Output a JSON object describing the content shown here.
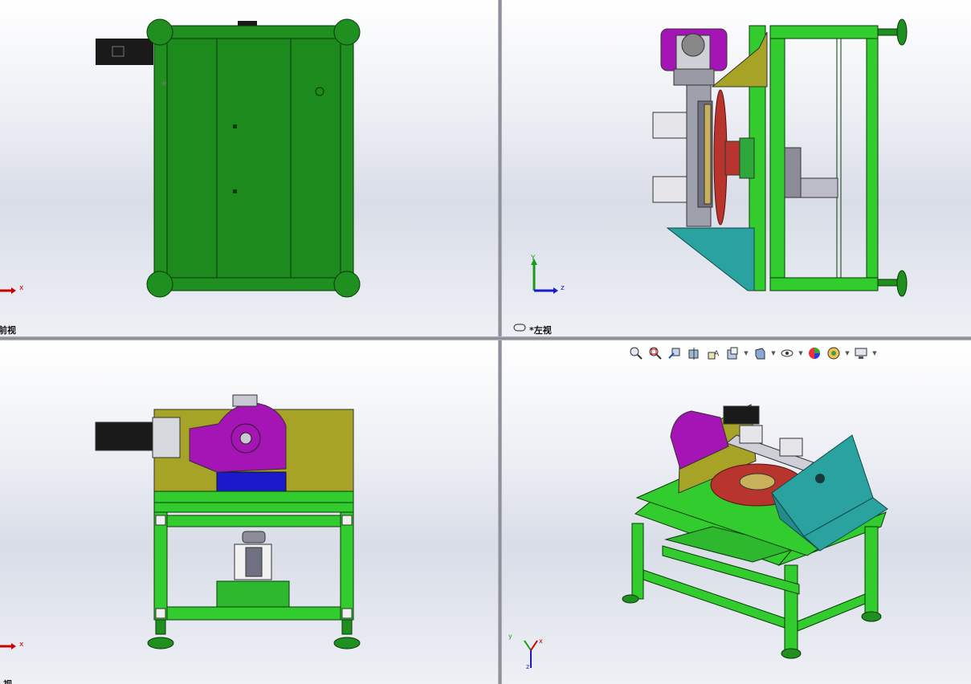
{
  "viewports": {
    "top_left": {
      "label": "前视",
      "triad": {
        "x": "x"
      }
    },
    "top_right": {
      "label": "*左视",
      "triad": {
        "y": "Y",
        "z": "z"
      }
    },
    "bottom_left": {
      "label": "视",
      "triad": {
        "x": "x"
      }
    },
    "bottom_right": {
      "triad": {
        "x": "x",
        "y": "y",
        "z": "z"
      }
    }
  },
  "heads_up_toolbar": [
    {
      "icon": "zoom-to-fit-icon"
    },
    {
      "icon": "zoom-to-area-icon"
    },
    {
      "icon": "previous-view-icon"
    },
    {
      "icon": "section-view-icon"
    },
    {
      "icon": "dynamic-annotation-icon"
    },
    {
      "icon": "view-orientation-icon",
      "dropdown": true
    },
    {
      "icon": "display-style-icon",
      "dropdown": true
    },
    {
      "icon": "hide-show-items-icon",
      "dropdown": true
    },
    {
      "icon": "edit-appearance-icon"
    },
    {
      "icon": "apply-scene-icon",
      "dropdown": true
    },
    {
      "icon": "view-settings-icon",
      "dropdown": true
    }
  ],
  "colors": {
    "frame_green": "#1f8f1f",
    "leg_green": "#33cc2e",
    "plate_olive": "#a7a327",
    "gearbox_purple": "#a514b4",
    "bracket_teal": "#2aa3a0",
    "disc_red": "#b8352e",
    "motor_black": "#1a1a1a",
    "axis_red": "#cc0000",
    "axis_green": "#1a9a1a",
    "axis_blue": "#1a1acc"
  }
}
